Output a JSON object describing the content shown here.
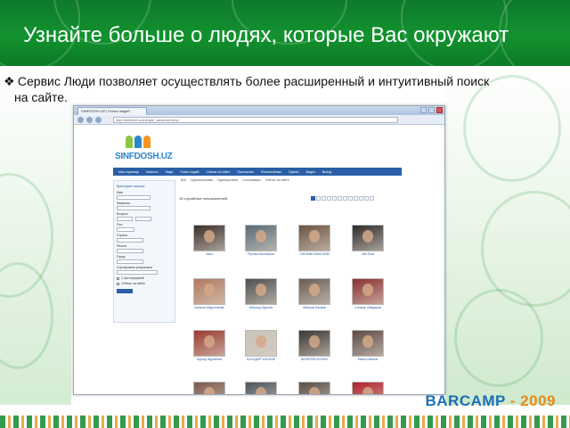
{
  "slide": {
    "title": "Узнайте больше о людях, которые Вас окружают",
    "bullet_symbol": "❖",
    "bullet_text": "Сервис Люди позволяет осуществлять более расширенный и интуитивный поиск",
    "bullet_text_cont": "на сайте.",
    "footer_brand": "BARCAMP",
    "footer_dash": " - ",
    "footer_year": "2009"
  },
  "browser": {
    "tab_title": "SINFDOSH.UZ | Поиск людей",
    "url": "http://sinfdosh.uz/people_advanced.php",
    "logo_text": "SINFDOSH.UZ",
    "menu": [
      "Моя страница",
      "Новости",
      "Люди",
      "Поиск людей",
      "Сейчас на сайте",
      "Пригласить",
      "Фотоальбомы",
      "Группы",
      "Видео",
      "Выход"
    ],
    "submenu": [
      "Все",
      "Одноклассники",
      "Однокурсники",
      "Сослуживцы",
      "Сейчас на сайте"
    ],
    "sidebar": {
      "title": "Критерии поиска",
      "labels": [
        "Имя",
        "Фамилия",
        "Возраст",
        "Пол",
        "Страна",
        "Регион",
        "Город",
        "Сортировать результаты"
      ],
      "check_photo": "С фотографией",
      "check_online": "Сейчас на сайте",
      "search_button": "Искать"
    },
    "results_title": "16 случайных пользователей",
    "people": [
      "Азиз",
      "Рустам Бахтиёров",
      "ОЛЕЖИК МАМУКОВ",
      "Jeff Zhuk",
      "Камила Абдуллаева",
      "Шерзод Одилов",
      "Максим Бакаев",
      "Санжар Хайдаров",
      "Мурод Журабоев",
      "БАХОДИР АЗИЗОВ",
      "ВАЛЕРИЙ МУХИН",
      "Миша Иванов",
      "",
      "",
      "",
      ""
    ],
    "photo_colors": [
      "#3a2f2a",
      "#5a6b78",
      "#6b5442",
      "#2c2c2c",
      "#b07a5f",
      "#4f4f4f",
      "#6a5d55",
      "#8a3030",
      "#9a3a2f",
      "#c8c2b8",
      "#3b3632",
      "#5c4a45",
      "#7a5a4a",
      "#4d5560",
      "#5a5048",
      "#b0202a"
    ]
  }
}
